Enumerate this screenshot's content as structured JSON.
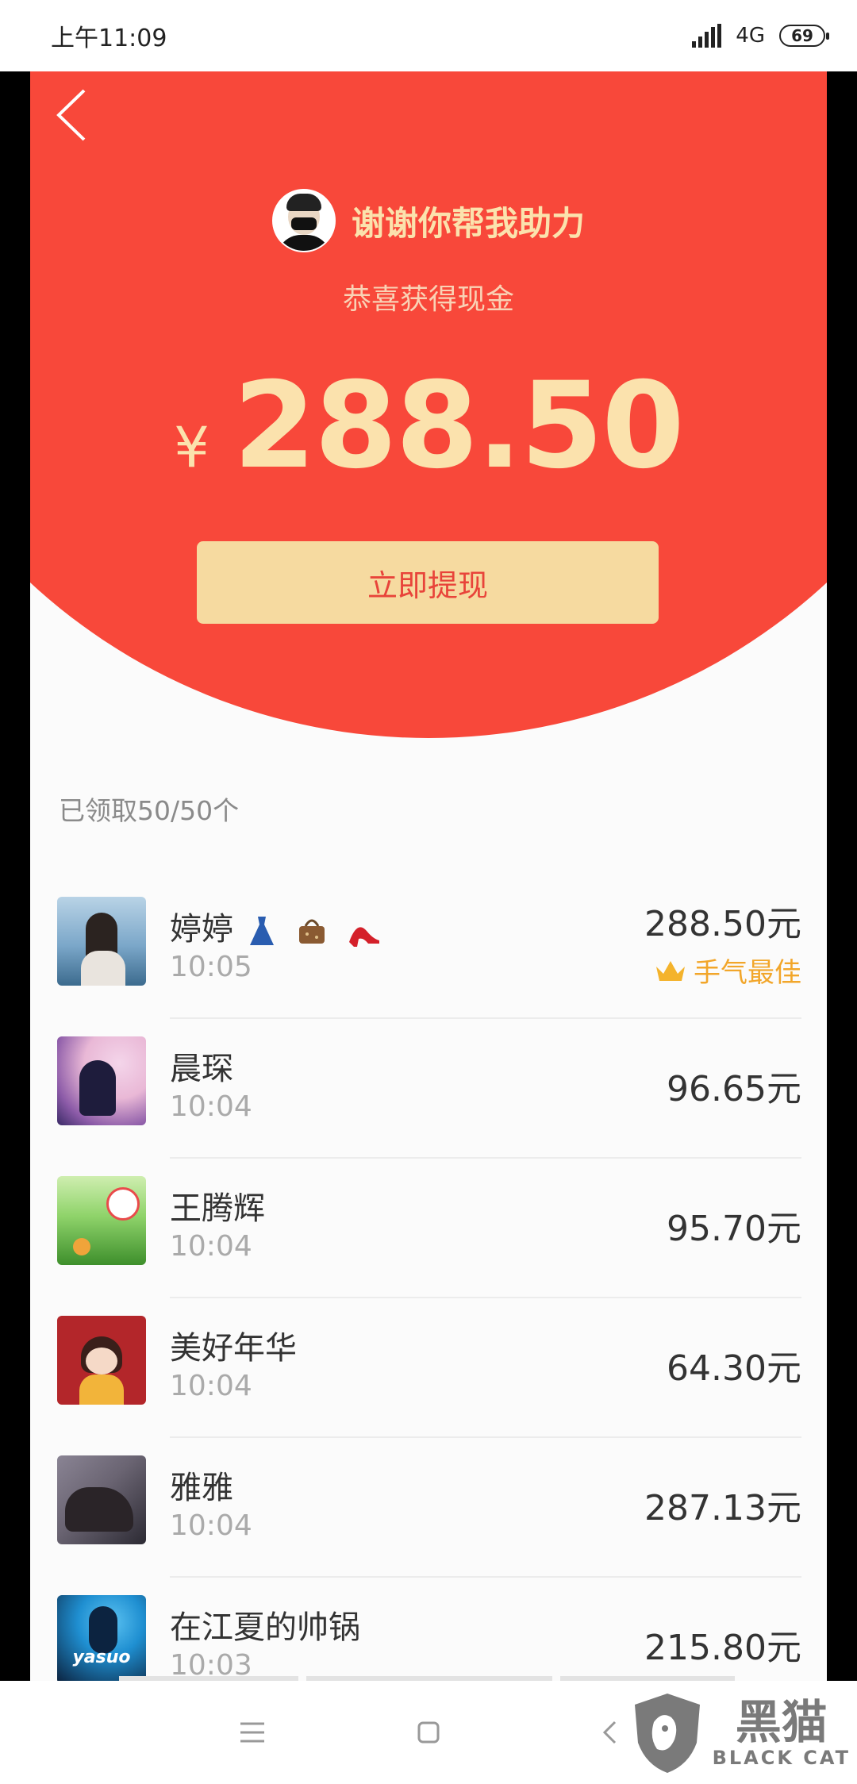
{
  "status_bar": {
    "time": "上午11:09",
    "network": "4G",
    "battery": "69"
  },
  "header": {
    "title": "谢谢你帮我助力",
    "subtitle": "恭喜获得现金"
  },
  "amount": {
    "currency": "¥",
    "value": "288.50"
  },
  "withdraw_button": "立即提现",
  "claimed_text": "已领取50/50个",
  "best_label": "手气最佳",
  "records": [
    {
      "name": "婷婷",
      "time": "10:05",
      "amount": "288.50元",
      "avatar_colors": [
        "#7ba7c9",
        "#d7e6ef"
      ],
      "best": true
    },
    {
      "name": "晨琛",
      "time": "10:04",
      "amount": "96.65元",
      "avatar_colors": [
        "#e9b8d6",
        "#4a3a78"
      ]
    },
    {
      "name": "王腾辉",
      "time": "10:04",
      "amount": "95.70元",
      "avatar_colors": [
        "#8fd36a",
        "#3e8f2c"
      ]
    },
    {
      "name": "美好年华",
      "time": "10:04",
      "amount": "64.30元",
      "avatar_colors": [
        "#b3262a",
        "#f5d9c7"
      ]
    },
    {
      "name": "雅雅",
      "time": "10:04",
      "amount": "287.13元",
      "avatar_colors": [
        "#6a6472",
        "#2c2a33"
      ]
    },
    {
      "name": "在江夏的帅锅",
      "time": "10:03",
      "amount": "215.80元",
      "avatar_colors": [
        "#1f8fd1",
        "#0b1f3a"
      ],
      "avatar_text": "yasuo"
    }
  ],
  "watermark": {
    "cn": "黑猫",
    "en": "BLACK CAT"
  },
  "colors": {
    "red": "#f8483a",
    "gold": "#fbe2ad",
    "button": "#f6daa0",
    "best": "#f2a62a"
  }
}
